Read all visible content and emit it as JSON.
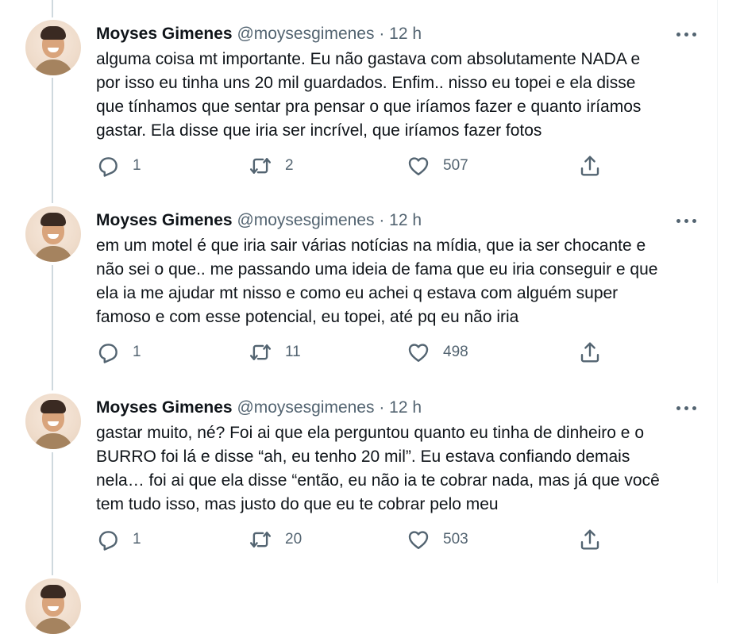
{
  "tweets": [
    {
      "author": "Moyses Gimenes",
      "handle": "@moysesgimenes",
      "separator": "·",
      "time": "12 h",
      "text": "alguma coisa mt importante. Eu não gastava com absolutamente NADA e\npor isso eu tinha uns 20 mil guardados. Enfim.. nisso eu topei e ela disse\nque tínhamos que sentar pra pensar o que iríamos fazer e quanto iríamos\ngastar. Ela disse que iria ser incrível, que iríamos fazer fotos",
      "replies": "1",
      "retweets": "2",
      "likes": "507"
    },
    {
      "author": "Moyses Gimenes",
      "handle": "@moysesgimenes",
      "separator": "·",
      "time": "12 h",
      "text": "em um motel é que iria sair várias notícias na mídia, que ia ser chocante e\nnão sei o que.. me passando uma ideia de fama que eu iria conseguir e que\nela ia me ajudar mt nisso e como eu achei q estava com alguém super\nfamoso e com esse potencial, eu topei, até pq eu não iria",
      "replies": "1",
      "retweets": "11",
      "likes": "498"
    },
    {
      "author": "Moyses Gimenes",
      "handle": "@moysesgimenes",
      "separator": "·",
      "time": "12 h",
      "text": "gastar muito, né? Foi ai que ela perguntou quanto eu tinha de dinheiro e o\nBURRO foi lá e disse “ah, eu tenho 20 mil”. Eu estava confiando demais\nnela… foi ai que ela disse “então, eu não ia te cobrar nada, mas já que você\ntem tudo isso, mas justo do que eu te cobrar pelo meu",
      "replies": "1",
      "retweets": "20",
      "likes": "503"
    }
  ],
  "icons": {
    "reply": "reply-icon",
    "retweet": "retweet-icon",
    "like": "heart-icon",
    "share": "share-icon",
    "more": "more-options-icon"
  },
  "colors": {
    "text": "#0f1419",
    "secondary": "#536471",
    "thread_line": "#cfd9de",
    "background": "#ffffff"
  }
}
